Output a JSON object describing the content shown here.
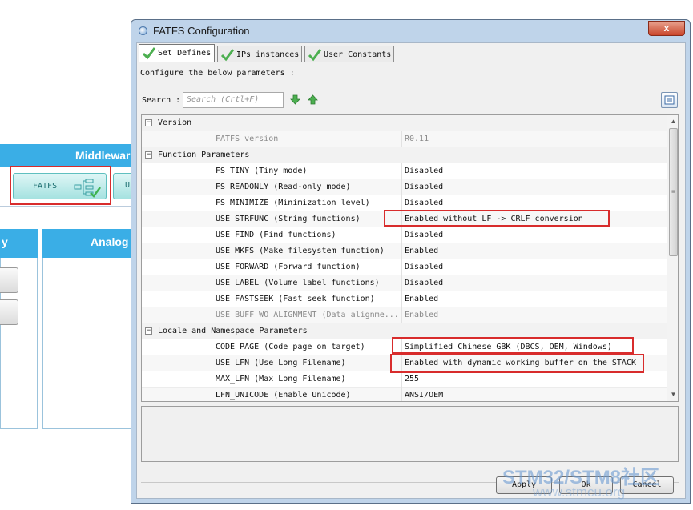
{
  "background": {
    "middleware_header": "Middlewar",
    "fatfs_button_label": "FATFS",
    "next_button_label": "U",
    "left_section_header": "y",
    "analog_section_header": "Analog"
  },
  "dialog": {
    "title": "FATFS Configuration",
    "close_label": "x",
    "tabs": [
      {
        "label": "Set Defines",
        "active": true
      },
      {
        "label": "IPs instances",
        "active": false
      },
      {
        "label": "User Constants",
        "active": false
      }
    ],
    "instruction": "Configure the below parameters :",
    "search": {
      "label": "Search :",
      "placeholder": "Search (Crtl+F)"
    },
    "grid": {
      "rows": [
        {
          "type": "category",
          "label": "Version"
        },
        {
          "type": "param",
          "name": "FATFS version",
          "value": "R0.11",
          "disabled": true
        },
        {
          "type": "category",
          "label": "Function Parameters"
        },
        {
          "type": "param",
          "name": "FS_TINY (Tiny mode)",
          "value": "Disabled"
        },
        {
          "type": "param",
          "name": "FS_READONLY (Read-only mode)",
          "value": "Disabled"
        },
        {
          "type": "param",
          "name": "FS_MINIMIZE (Minimization level)",
          "value": "Disabled"
        },
        {
          "type": "param",
          "name": "USE_STRFUNC (String functions)",
          "value": "Enabled without LF -> CRLF conversion",
          "highlighted": true
        },
        {
          "type": "param",
          "name": "USE_FIND (Find functions)",
          "value": "Disabled"
        },
        {
          "type": "param",
          "name": "USE_MKFS (Make filesystem function)",
          "value": "Enabled"
        },
        {
          "type": "param",
          "name": "USE_FORWARD (Forward function)",
          "value": "Disabled"
        },
        {
          "type": "param",
          "name": "USE_LABEL (Volume label functions)",
          "value": "Disabled"
        },
        {
          "type": "param",
          "name": "USE_FASTSEEK (Fast seek function)",
          "value": "Enabled"
        },
        {
          "type": "param",
          "name": "USE_BUFF_WO_ALIGNMENT (Data alignme...",
          "value": "Enabled",
          "disabled": true
        },
        {
          "type": "category",
          "label": "Locale and Namespace Parameters"
        },
        {
          "type": "param",
          "name": "CODE_PAGE (Code page on target)",
          "value": "Simplified Chinese GBK (DBCS, OEM, Windows)",
          "highlighted": true
        },
        {
          "type": "param",
          "name": "USE_LFN (Use Long Filename)",
          "value": "Enabled with dynamic working buffer on the STACK",
          "highlighted": true
        },
        {
          "type": "param",
          "name": "MAX_LFN (Max Long Filename)",
          "value": "255"
        },
        {
          "type": "param",
          "name": "LFN_UNICODE (Enable Unicode)",
          "value": "ANSI/OEM"
        }
      ]
    },
    "buttons": {
      "apply": "Apply",
      "ok": "Ok",
      "cancel": "Cancel"
    }
  },
  "watermark": {
    "line1": "STM32/STM8社区",
    "line2": "www.stmcu.org"
  },
  "colors": {
    "accent_blue": "#3aaee6",
    "highlight_red": "#d82c2c",
    "check_green": "#4caf50"
  }
}
